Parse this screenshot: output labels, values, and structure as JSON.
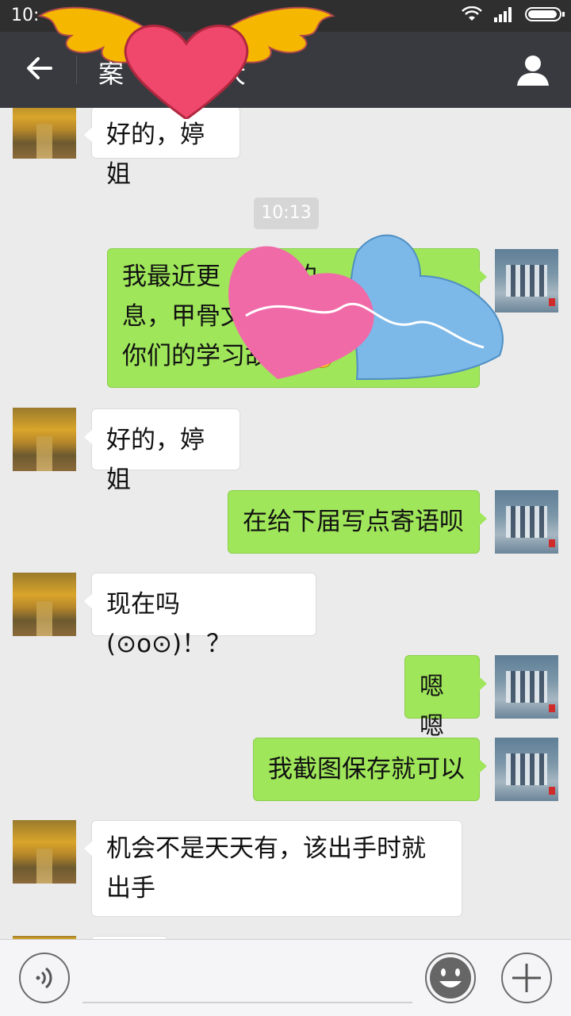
{
  "status": {
    "time": "10:"
  },
  "header": {
    "title": "案",
    "title_tail": "大"
  },
  "chat": {
    "timestamp": "10:13",
    "messages": [
      {
        "side": "in",
        "text": "好的，婷姐"
      },
      {
        "side": "out",
        "text": "我最近更…们的…息，甲骨文…你们的学习故…"
      },
      {
        "side": "in",
        "text": "好的，婷姐"
      },
      {
        "side": "out",
        "text": "在给下届写点寄语呗"
      },
      {
        "side": "in",
        "text": "现在吗(⊙o⊙)！？"
      },
      {
        "side": "out",
        "text": "嗯嗯"
      },
      {
        "side": "out",
        "text": "我截图保存就可以"
      },
      {
        "side": "in",
        "text": "机会不是天天有，该出手时就出手"
      }
    ],
    "m1_line1": "我最近更",
    "m1_line1b": "们的",
    "m1_line2": "息，甲骨文",
    "m1_line3": "你们的学习故",
    "m7_line1": "机会不是天天有，该出手时就",
    "m7_line2": "出手"
  },
  "colors": {
    "outgoing": "#9fe65a",
    "incoming": "#ffffff",
    "header": "#393a3f"
  },
  "icons": [
    "back-arrow-icon",
    "user-icon",
    "voice-icon",
    "emoji-icon",
    "plus-icon",
    "wifi-icon",
    "signal-icon",
    "battery-icon",
    "thumbs-up-icon"
  ]
}
